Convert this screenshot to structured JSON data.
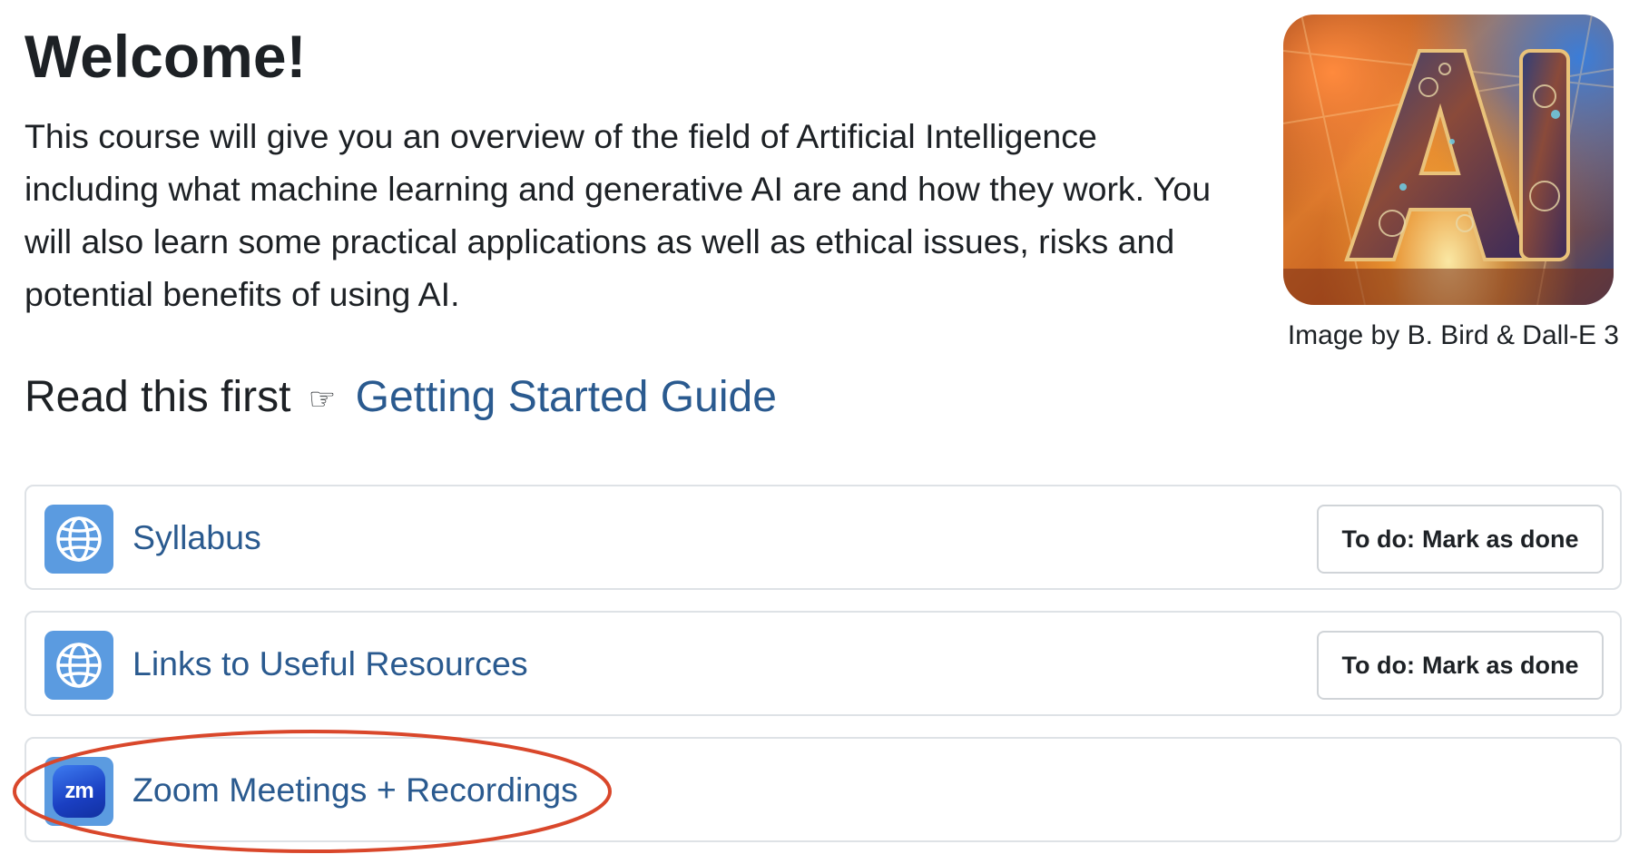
{
  "welcome": {
    "heading": "Welcome!",
    "intro": "This course will give you an overview of the field of Artificial Intelligence including what machine learning and generative AI are and how they work. You will also learn some practical applications as well as ethical issues, risks and potential benefits of using AI.",
    "image_text": "AI",
    "image_caption": "Image by B. Bird & Dall-E 3"
  },
  "read_first": {
    "lead": "Read this first",
    "pointer_icon": "pointing-hand-icon",
    "pointer_glyph": "☞",
    "link_label": "Getting Started Guide"
  },
  "activities": [
    {
      "title": "Syllabus",
      "icon": "globe-icon",
      "completion": {
        "prefix": "To do:",
        "label": "Mark as done"
      }
    },
    {
      "title": "Links to Useful Resources",
      "icon": "globe-icon",
      "completion": {
        "prefix": "To do:",
        "label": "Mark as done"
      }
    },
    {
      "title": "Zoom Meetings + Recordings",
      "icon": "zoom-icon",
      "icon_text": "zm"
    }
  ],
  "colors": {
    "link": "#2a5a8f",
    "icon_bg": "#5b9be0",
    "annotation": "#d9472b",
    "border": "#dee2e6"
  }
}
